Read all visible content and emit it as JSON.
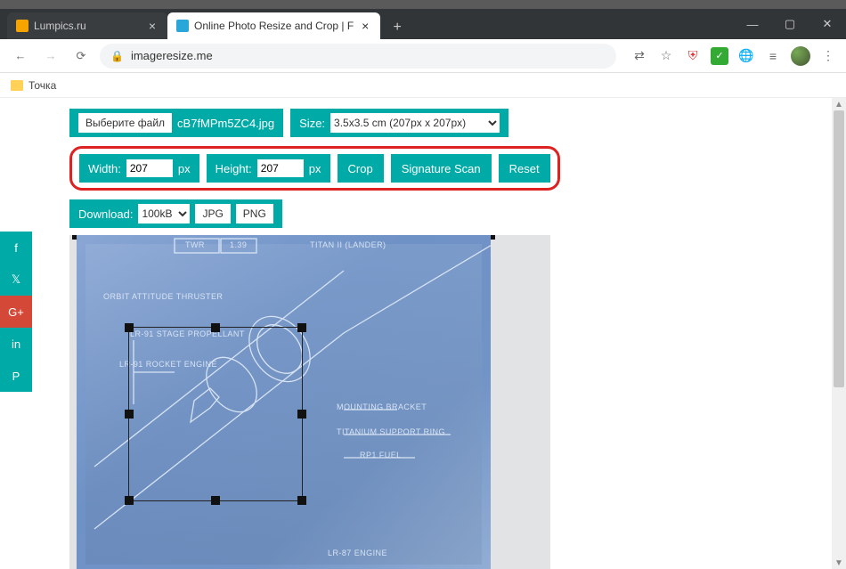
{
  "window": {
    "minimize": "—",
    "maximize": "▢",
    "close": "✕"
  },
  "tabs": [
    {
      "title": "Lumpics.ru",
      "active": false,
      "icon_bg": "#f7a400"
    },
    {
      "title": "Online Photo Resize and Crop | F",
      "active": true,
      "icon_bg": "#2aa7d8"
    }
  ],
  "newtab": "+",
  "nav": {
    "back": "←",
    "forward": "→",
    "reload": "⟳"
  },
  "address": {
    "lock": "🔒",
    "url": "imageresize.me"
  },
  "ext": {
    "translate": "⇄",
    "star": "☆",
    "ab": "⛨",
    "chk": "✓",
    "globe": "🌐",
    "menu": "≡",
    "dots": "⋮"
  },
  "bookmarks": [
    {
      "label": "Точка"
    }
  ],
  "social": {
    "facebook": "f",
    "twitter": "𝕏",
    "gplus": "G+",
    "linkedin": "in",
    "pinterest": "P"
  },
  "toolbar": {
    "choose_file": "Выберите файл",
    "filename": "cB7fMPm5ZC4.jpg",
    "size_label": "Size:",
    "size_value": "3.5x3.5 cm (207px x 207px)",
    "width_label": "Width:",
    "width_value": "207",
    "width_unit": "px",
    "height_label": "Height:",
    "height_value": "207",
    "height_unit": "px",
    "crop": "Crop",
    "signature_scan": "Signature Scan",
    "reset": "Reset",
    "download_label": "Download:",
    "download_size": "100kB",
    "jpg": "JPG",
    "png": "PNG"
  },
  "photo_labels": {
    "twr": "TWR",
    "val": "1.39",
    "right_title": "TITAN II (LANDER)",
    "thruster": "ORBIT ATTITUDE THRUSTER",
    "propellant": "LR-91 STAGE PROPELLANT",
    "engine": "LR-91 ROCKET ENGINE",
    "bracket": "MOUNTING BRACKET",
    "ring": "TITANIUM SUPPORT RING",
    "fuel": "RP1 FUEL",
    "bottomengine": "LR-87 ENGINE"
  }
}
